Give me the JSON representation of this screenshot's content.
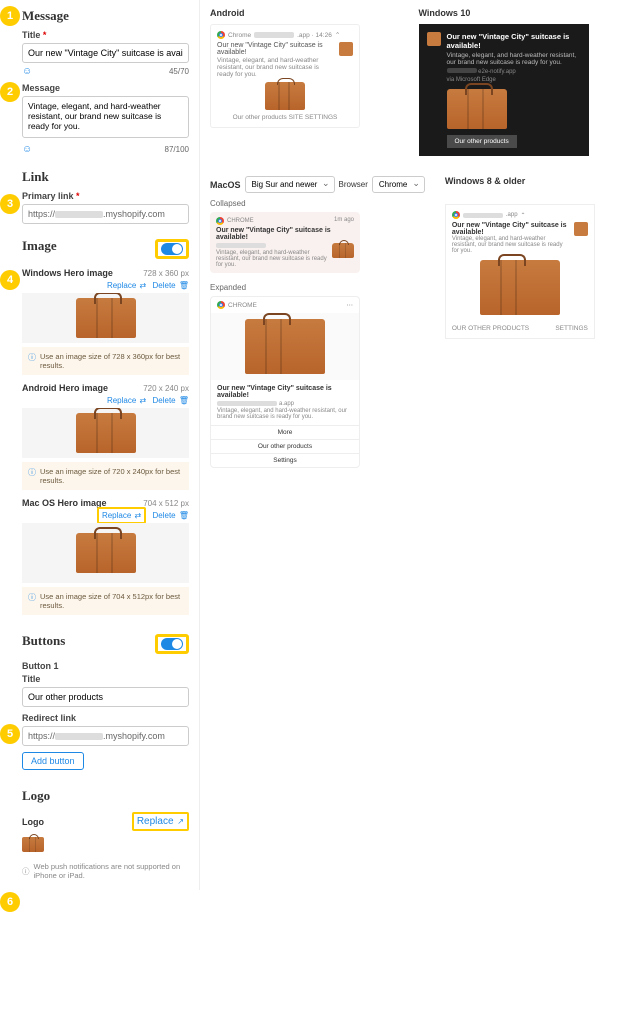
{
  "message": {
    "section": "Message",
    "title_label": "Title",
    "title_value": "Our new \"Vintage City\" suitcase is available!",
    "title_counter": "45/70",
    "msg_label": "Message",
    "msg_value": "Vintage, elegant, and hard-weather resistant, our brand new suitcase is ready for you.",
    "msg_counter": "87/100"
  },
  "link": {
    "section": "Link",
    "label": "Primary link",
    "prefix": "https://",
    "suffix": ".myshopify.com"
  },
  "image": {
    "section": "Image",
    "windows": {
      "label": "Windows Hero image",
      "dim": "728 x 360 px",
      "hint": "Use an image size of 728 x 360px for best results."
    },
    "android": {
      "label": "Android Hero image",
      "dim": "720 x 240 px",
      "hint": "Use an image size of 720 x 240px for best results."
    },
    "macos": {
      "label": "Mac OS Hero image",
      "dim": "704 x 512 px",
      "hint": "Use an image size of 704 x 512px for best results."
    },
    "replace": "Replace",
    "delete": "Delete"
  },
  "buttons": {
    "section": "Buttons",
    "b1_label": "Button 1",
    "title_label": "Title",
    "title_value": "Our other products",
    "redirect_label": "Redirect link",
    "add": "Add button"
  },
  "logo": {
    "section": "Logo",
    "label": "Logo",
    "replace": "Replace"
  },
  "footer_note": "Web push notifications are not supported on iPhone or iPad.",
  "previews": {
    "android": {
      "label": "Android",
      "chrome": "Chrome",
      "time": ".app · 14:26",
      "title": "Our new \"Vintage City\" suitcase is available!",
      "msg": "Vintage, elegant, and hard-weather resistant, our brand new suitcase is ready for you.",
      "foot": "Our other products  SITE SETTINGS"
    },
    "win10": {
      "label": "Windows 10",
      "title": "Our new \"Vintage City\" suitcase is available!",
      "msg": "Vintage, elegant, and hard-weather resistant, our brand new suitcase is ready for you.",
      "sub1": "e2e-notify.app",
      "sub2": "via Microsoft Edge",
      "btn": "Our other products"
    },
    "macos": {
      "label": "MacOS",
      "os_select": "Big Sur and newer",
      "browser_label": "Browser",
      "browser_select": "Chrome",
      "collapsed_label": "Collapsed",
      "expanded_label": "Expanded",
      "chrome": "CHROME",
      "time": "1m ago",
      "title": "Our new \"Vintage City\" suitcase is available!",
      "msg": "Vintage, elegant, and hard-weather resistant, our brand new suitcase is ready for you.",
      "domain": "a.app",
      "more": "More",
      "btn1": "Our other products",
      "btn2": "Settings"
    },
    "win8": {
      "label": "Windows 8 & older",
      "title": "Our new \"Vintage City\" suitcase is available!",
      "msg": "Vintage, elegant, and hard-weather resistant, our brand new suitcase is ready for you.",
      "foot1": "OUR OTHER PRODUCTS",
      "foot2": "SETTINGS"
    }
  }
}
